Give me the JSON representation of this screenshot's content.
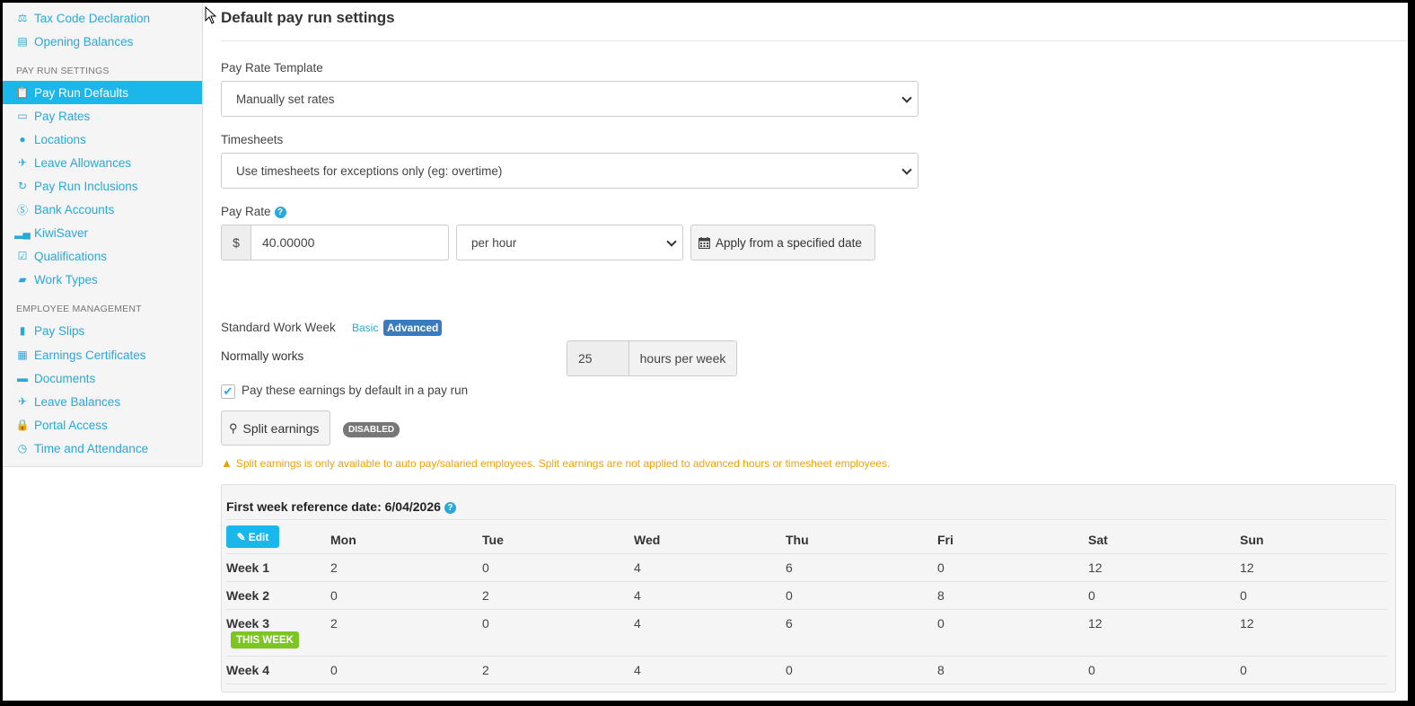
{
  "sidebar": {
    "top_items": [
      {
        "label": "Tax Code Declaration",
        "icon": "scale-icon"
      },
      {
        "label": "Opening Balances",
        "icon": "ledger-icon"
      }
    ],
    "pay_run_heading": "PAY RUN SETTINGS",
    "pay_run_items": [
      {
        "label": "Pay Run Defaults",
        "icon": "clipboard-icon"
      },
      {
        "label": "Pay Rates",
        "icon": "money-icon"
      },
      {
        "label": "Locations",
        "icon": "globe-icon"
      },
      {
        "label": "Leave Allowances",
        "icon": "plane-icon"
      },
      {
        "label": "Pay Run Inclusions",
        "icon": "refresh-icon"
      },
      {
        "label": "Bank Accounts",
        "icon": "dollar-circle-icon"
      },
      {
        "label": "KiwiSaver",
        "icon": "signal-bars-icon"
      },
      {
        "label": "Qualifications",
        "icon": "checkbox-icon"
      },
      {
        "label": "Work Types",
        "icon": "book-icon"
      }
    ],
    "employee_heading": "EMPLOYEE MANAGEMENT",
    "employee_items": [
      {
        "label": "Pay Slips",
        "icon": "file-icon"
      },
      {
        "label": "Earnings Certificates",
        "icon": "calculator-icon"
      },
      {
        "label": "Documents",
        "icon": "folder-icon"
      },
      {
        "label": "Leave Balances",
        "icon": "plane-icon"
      },
      {
        "label": "Portal Access",
        "icon": "lock-icon"
      },
      {
        "label": "Time and Attendance",
        "icon": "clock-icon"
      }
    ],
    "active_item": "Pay Run Defaults"
  },
  "main": {
    "title": "Default pay run settings",
    "pay_rate_template": {
      "label": "Pay Rate Template",
      "value": "Manually set rates"
    },
    "timesheets": {
      "label": "Timesheets",
      "value": "Use timesheets for exceptions only (eg: overtime)"
    },
    "pay_rate": {
      "label": "Pay Rate",
      "currency": "$",
      "value": "40.00000",
      "unit": "per hour",
      "apply_button": "Apply from a specified date"
    },
    "standard_work_week": {
      "label": "Standard Work Week",
      "basic": "Basic",
      "advanced": "Advanced",
      "normally_works": "Normally works",
      "hours": "25",
      "hours_unit": "hours per week"
    },
    "pay_default_checkbox": {
      "label": "Pay these earnings by default in a pay run",
      "checked": true
    },
    "split_earnings": {
      "button": "Split earnings",
      "badge": "DISABLED",
      "warning": "Split earnings is only available to auto pay/salaried employees. Split earnings are not applied to advanced hours or timesheet employees."
    },
    "week_table": {
      "reference_label": "First week reference date: 6/04/2026",
      "edit_button": "Edit",
      "days": [
        "Mon",
        "Tue",
        "Wed",
        "Thu",
        "Fri",
        "Sat",
        "Sun"
      ],
      "weeks": [
        {
          "label": "Week 1",
          "hours": [
            "2",
            "0",
            "4",
            "6",
            "0",
            "12",
            "12"
          ]
        },
        {
          "label": "Week 2",
          "hours": [
            "0",
            "2",
            "4",
            "0",
            "8",
            "0",
            "0"
          ]
        },
        {
          "label": "Week 3",
          "hours": [
            "2",
            "0",
            "4",
            "6",
            "0",
            "12",
            "12"
          ],
          "badge": "THIS WEEK"
        },
        {
          "label": "Week 4",
          "hours": [
            "0",
            "2",
            "4",
            "0",
            "8",
            "0",
            "0"
          ]
        }
      ]
    }
  },
  "colors": {
    "accent": "#1bb7ea",
    "link": "#2aa8d8",
    "warning": "#f0a20a",
    "this_week": "#7cc522",
    "advanced": "#3a7bbf"
  }
}
